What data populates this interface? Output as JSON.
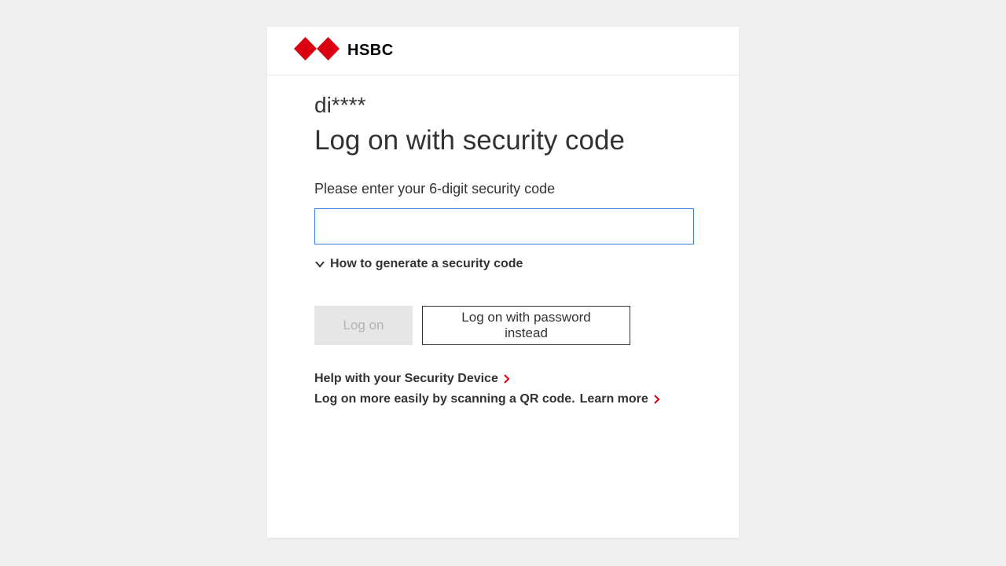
{
  "brand": {
    "name": "HSBC",
    "accent_red": "#db0011",
    "focus_blue": "#3b7ddd"
  },
  "username_masked": "di****",
  "title": "Log on with security code",
  "prompt": "Please enter your 6-digit security code",
  "security_code_value": "",
  "expander_label": "How to generate a security code",
  "buttons": {
    "primary": "Log on",
    "secondary": "Log on with password instead"
  },
  "links": {
    "help_device": "Help with your Security Device",
    "qr_lead": "Log on more easily by scanning a QR code.",
    "qr_learn": "Learn more"
  }
}
